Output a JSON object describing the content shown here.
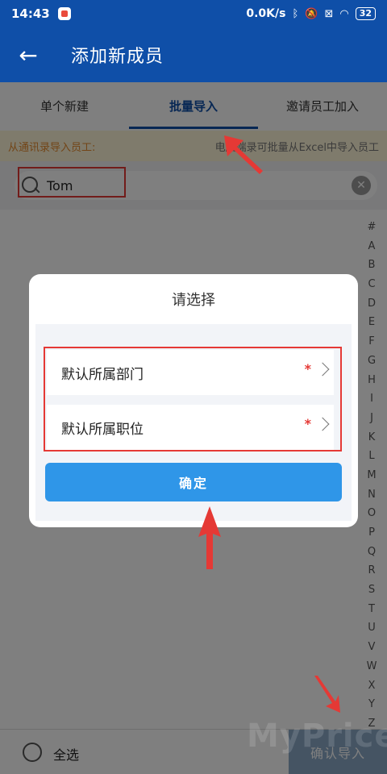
{
  "status": {
    "time": "14:43",
    "speed": "0.0K/s",
    "battery": "32",
    "icons": [
      "app-icon",
      "bluetooth-icon",
      "mute-icon",
      "sim-icon",
      "wifi-icon",
      "battery-icon"
    ]
  },
  "header": {
    "title": "添加新成员",
    "back_icon": "back-arrow-icon"
  },
  "tabs": [
    {
      "label": "单个新建",
      "active": false
    },
    {
      "label": "批量导入",
      "active": true
    },
    {
      "label": "邀请员工加入",
      "active": false
    }
  ],
  "notice": {
    "left": "从通讯录导入员工:",
    "right": "电脑端录可批量从Excel中导入员工"
  },
  "search": {
    "value": "Tom",
    "placeholder": ""
  },
  "index_letters": [
    "#",
    "A",
    "B",
    "C",
    "D",
    "E",
    "F",
    "G",
    "H",
    "I",
    "J",
    "K",
    "L",
    "M",
    "N",
    "O",
    "P",
    "Q",
    "R",
    "S",
    "T",
    "U",
    "V",
    "W",
    "X",
    "Y",
    "Z"
  ],
  "bottom": {
    "select_all": "全选",
    "confirm_import": "确认导入"
  },
  "dialog": {
    "title": "请选择",
    "rows": [
      {
        "label": "默认所属部门",
        "required": "*"
      },
      {
        "label": "默认所属职位",
        "required": "*"
      }
    ],
    "confirm": "确定"
  },
  "watermark": "MyPrice",
  "colors": {
    "primary": "#0f4fa8",
    "button_blue": "#2f96e8",
    "annotation_red": "#e53935",
    "notice_orange": "#e58a2e"
  }
}
